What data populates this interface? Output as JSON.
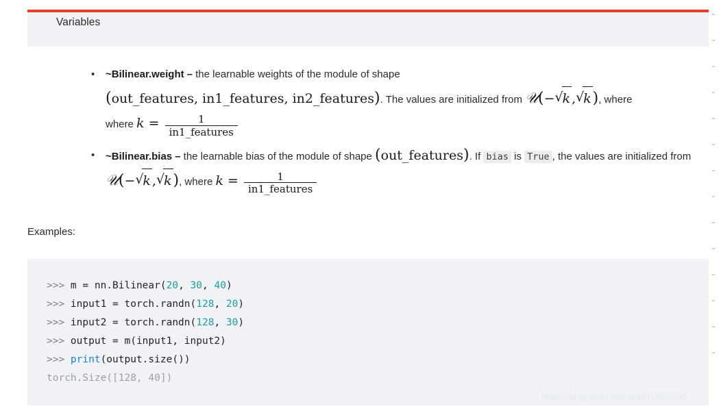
{
  "header": {
    "accent_color": "#e8402a",
    "band_color": "#f0f2f5",
    "title": "Variables"
  },
  "variables": [
    {
      "name": "~Bilinear.weight",
      "dash": "–",
      "desc_1": "the learnable weights of the module of shape",
      "math_shape": "(out_features, in1_features, in2_features)",
      "desc_2": ". The values are initialized from",
      "math_dist": "ᵊ(−√k, √k)",
      "desc_3": ", where",
      "math_k": "k = 1 / in1_features",
      "frac_num": "1",
      "frac_den": "in1_features"
    },
    {
      "name": "~Bilinear.bias",
      "dash": "–",
      "desc_1": "the learnable bias of the module of shape",
      "math_shape": "(out_features)",
      "desc_2": ". If",
      "code_bias": "bias",
      "desc_3": "is",
      "code_true": "True",
      "desc_4": ", the values are initialized from",
      "math_dist": "ᵊ(−√k, √k)",
      "desc_5": ", where",
      "math_k": "k = 1 / in1_features",
      "frac_num": "1",
      "frac_den": "in1_features"
    }
  ],
  "math_symbols": {
    "cal_u": "𝒰",
    "minus": "−",
    "k": "k",
    "equals": "=",
    "comma": ",",
    "lparen": "(",
    "rparen": ")",
    "shape_weight_open": "(",
    "shape_weight_text": "out_features, in1_features, in2_features",
    "shape_weight_close": ")",
    "shape_bias_open": "(",
    "shape_bias_text": "out_features",
    "shape_bias_close": ")",
    "where": "where"
  },
  "examples": {
    "label": "Examples:",
    "background": "#f0f2f5",
    "lines": [
      {
        "prompt": ">>> ",
        "tokens": [
          {
            "t": "m = nn.Bilinear(",
            "c": "code"
          },
          {
            "t": "20",
            "c": "num"
          },
          {
            "t": ", ",
            "c": "code"
          },
          {
            "t": "30",
            "c": "num"
          },
          {
            "t": ", ",
            "c": "code"
          },
          {
            "t": "40",
            "c": "num"
          },
          {
            "t": ")",
            "c": "code"
          }
        ]
      },
      {
        "prompt": ">>> ",
        "tokens": [
          {
            "t": "input1 = torch.randn(",
            "c": "code"
          },
          {
            "t": "128",
            "c": "num"
          },
          {
            "t": ", ",
            "c": "code"
          },
          {
            "t": "20",
            "c": "num"
          },
          {
            "t": ")",
            "c": "code"
          }
        ]
      },
      {
        "prompt": ">>> ",
        "tokens": [
          {
            "t": "input2 = torch.randn(",
            "c": "code"
          },
          {
            "t": "128",
            "c": "num"
          },
          {
            "t": ", ",
            "c": "code"
          },
          {
            "t": "30",
            "c": "num"
          },
          {
            "t": ")",
            "c": "code"
          }
        ]
      },
      {
        "prompt": ">>> ",
        "tokens": [
          {
            "t": "output = m(input1, input2)",
            "c": "code"
          }
        ]
      },
      {
        "prompt": ">>> ",
        "tokens": [
          {
            "t": "print",
            "c": "builtin"
          },
          {
            "t": "(output.size())",
            "c": "code"
          }
        ]
      },
      {
        "prompt": "",
        "tokens": [
          {
            "t": "torch.Size([128, 40])",
            "c": "out"
          }
        ]
      }
    ],
    "colors": {
      "prompt": "#7b7f8b",
      "number": "#1a9e9e",
      "builtin": "#1a7fd4",
      "output": "#9aa0a6",
      "code": "#1f2328"
    }
  },
  "watermark": {
    "text": "https://blog.csdn.net/xpy870663266"
  }
}
